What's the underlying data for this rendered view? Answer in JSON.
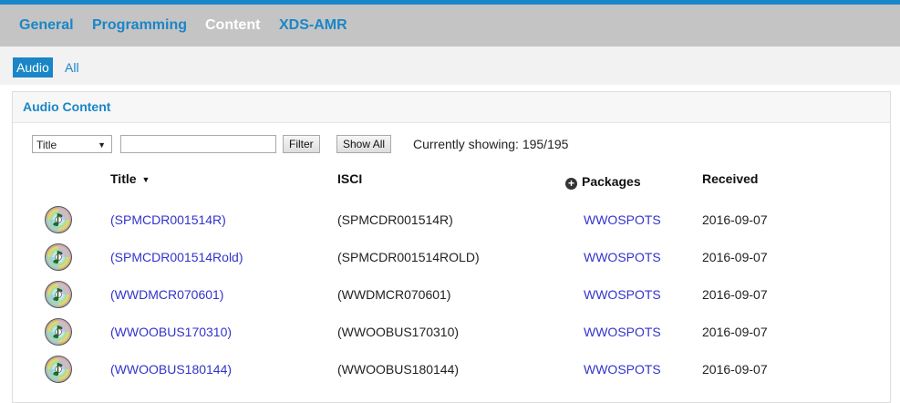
{
  "nav": {
    "tabs": [
      {
        "label": "General",
        "active": false
      },
      {
        "label": "Programming",
        "active": false
      },
      {
        "label": "Content",
        "active": true
      },
      {
        "label": "XDS-AMR",
        "active": false
      }
    ]
  },
  "subnav": {
    "tabs": [
      {
        "label": "Audio",
        "active": true
      },
      {
        "label": "All",
        "active": false
      }
    ]
  },
  "panel": {
    "title": "Audio Content",
    "filter": {
      "field_selected": "Title",
      "search_value": "",
      "filter_label": "Filter",
      "show_all_label": "Show All",
      "showing_text": "Currently showing: 195/195"
    },
    "columns": {
      "title": "Title",
      "isci": "ISCI",
      "packages": "Packages",
      "received": "Received"
    },
    "rows": [
      {
        "icon": "cd-audio-icon",
        "title": "(SPMCDR001514R)",
        "isci": "(SPMCDR001514R)",
        "packages": "WWOSPOTS",
        "received": "2016-09-07"
      },
      {
        "icon": "cd-audio-icon",
        "title": "(SPMCDR001514Rold)",
        "isci": "(SPMCDR001514ROLD)",
        "packages": "WWOSPOTS",
        "received": "2016-09-07"
      },
      {
        "icon": "cd-audio-icon",
        "title": "(WWDMCR070601)",
        "isci": "(WWDMCR070601)",
        "packages": "WWOSPOTS",
        "received": "2016-09-07"
      },
      {
        "icon": "cd-audio-icon",
        "title": "(WWOOBUS170310)",
        "isci": "(WWOOBUS170310)",
        "packages": "WWOSPOTS",
        "received": "2016-09-07"
      },
      {
        "icon": "cd-audio-icon",
        "title": "(WWOOBUS180144)",
        "isci": "(WWOOBUS180144)",
        "packages": "WWOSPOTS",
        "received": "2016-09-07"
      }
    ]
  },
  "colors": {
    "accent": "#1a86c8",
    "link": "#3333cc",
    "nav_bg": "#c4c4c4"
  }
}
